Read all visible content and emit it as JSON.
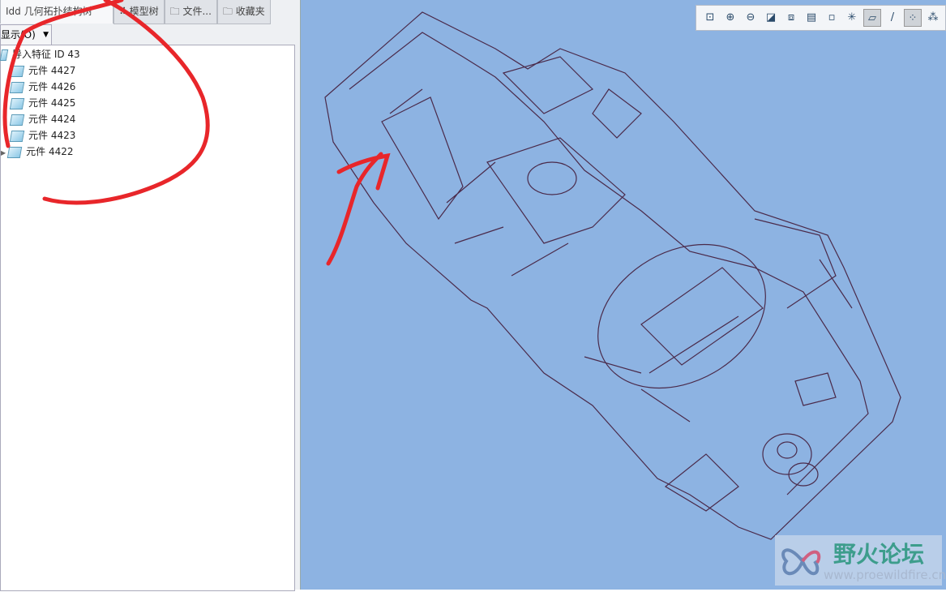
{
  "tabs": [
    {
      "label": "Idd 几何拓扑结构树",
      "icon": "tree-icon"
    },
    {
      "label": "模型树",
      "icon": "model-tree-icon"
    },
    {
      "label": "文件...",
      "icon": "folder-icon"
    },
    {
      "label": "收藏夹",
      "icon": "favorites-icon"
    }
  ],
  "show_button": "显示(O)",
  "tree": {
    "root": "导入特征 ID 43",
    "items": [
      "元件 4427",
      "元件 4426",
      "元件 4425",
      "元件 4424",
      "元件 4423",
      "元件 4422"
    ]
  },
  "toolbar": [
    "refit-icon",
    "zoom-in-icon",
    "zoom-out-icon",
    "repaint-icon",
    "display-style-icon",
    "saved-views-icon",
    "view-manager-icon",
    "datum-axis-display-icon",
    "plane-display-icon",
    "axis-display-icon",
    "point-display-icon",
    "csys-display-icon"
  ],
  "watermark": {
    "title": "野火论坛",
    "url": "www.proewildfire.cn"
  },
  "colors": {
    "viewport": "#8db3e2",
    "wireframe": "#4a2a4a",
    "annotation": "#e8262a"
  }
}
